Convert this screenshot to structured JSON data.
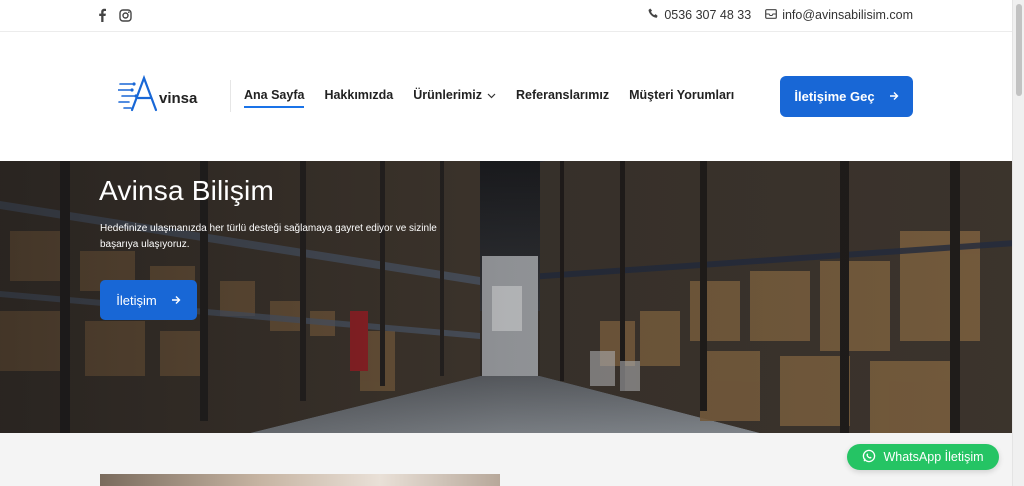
{
  "topbar": {
    "social": [
      "facebook-icon",
      "instagram-icon"
    ],
    "phone": "0536 307 48 33",
    "email": "info@avinsabilisim.com"
  },
  "header": {
    "logo_text": "vinsa",
    "nav": [
      {
        "label": "Ana Sayfa",
        "active": true
      },
      {
        "label": "Hakkımızda"
      },
      {
        "label": "Ürünlerimiz",
        "dropdown": true
      },
      {
        "label": "Referanslarımız"
      },
      {
        "label": "Müşteri Yorumları"
      }
    ],
    "cta_label": "İletişime Geç"
  },
  "hero": {
    "title": "Avinsa Bilişim",
    "text": "Hedefinize ulaşmanızda her türlü desteği sağlamaya gayret ediyor ve sizinle başarıya ulaşıyoruz.",
    "button_label": "İletişim"
  },
  "whatsapp": {
    "label": "WhatsApp İletişim"
  },
  "colors": {
    "primary": "#1867d6",
    "whatsapp": "#25c464"
  }
}
